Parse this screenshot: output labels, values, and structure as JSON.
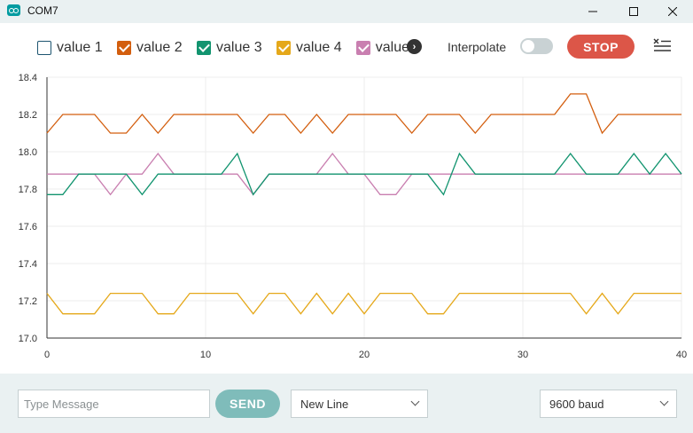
{
  "window": {
    "title": "COM7",
    "minimize_icon": "minimize-icon",
    "maximize_icon": "maximize-icon",
    "close_icon": "close-icon"
  },
  "toolbar": {
    "legend": [
      {
        "label": "value 1",
        "color": "#1d5570",
        "checked": false
      },
      {
        "label": "value 2",
        "color": "#d35e0e",
        "checked": true
      },
      {
        "label": "value 3",
        "color": "#12946f",
        "checked": true
      },
      {
        "label": "value 4",
        "color": "#e5a81a",
        "checked": true
      },
      {
        "label": "value",
        "color": "#c97fb0",
        "checked": true
      }
    ],
    "interpolate_label": "Interpolate",
    "interpolate_on": false,
    "stop_label": "STOP"
  },
  "bottom": {
    "message_placeholder": "Type Message",
    "message_value": "",
    "send_label": "SEND",
    "line_ending": "New Line",
    "baud_rate": "9600 baud"
  },
  "chart_data": {
    "type": "line",
    "title": "",
    "xlabel": "",
    "ylabel": "",
    "xlim": [
      0,
      40
    ],
    "ylim": [
      17.0,
      18.4
    ],
    "x_ticks": [
      0,
      10,
      20,
      30,
      40
    ],
    "y_ticks": [
      17.0,
      17.2,
      17.4,
      17.6,
      17.8,
      18.0,
      18.2,
      18.4
    ],
    "grid": true,
    "x": [
      0,
      1,
      2,
      3,
      4,
      5,
      6,
      7,
      8,
      9,
      10,
      11,
      12,
      13,
      14,
      15,
      16,
      17,
      18,
      19,
      20,
      21,
      22,
      23,
      24,
      25,
      26,
      27,
      28,
      29,
      30,
      31,
      32,
      33,
      34,
      35,
      36,
      37,
      38,
      39,
      40
    ],
    "series": [
      {
        "name": "value 2",
        "color": "#d35e0e",
        "values": [
          18.1,
          18.2,
          18.2,
          18.2,
          18.1,
          18.1,
          18.2,
          18.1,
          18.2,
          18.2,
          18.2,
          18.2,
          18.2,
          18.1,
          18.2,
          18.2,
          18.1,
          18.2,
          18.1,
          18.2,
          18.2,
          18.2,
          18.2,
          18.1,
          18.2,
          18.2,
          18.2,
          18.1,
          18.2,
          18.2,
          18.2,
          18.2,
          18.2,
          18.31,
          18.31,
          18.1,
          18.2,
          18.2,
          18.2,
          18.2,
          18.2
        ]
      },
      {
        "name": "value",
        "color": "#c97fb0",
        "values": [
          17.88,
          17.88,
          17.88,
          17.88,
          17.77,
          17.88,
          17.88,
          17.99,
          17.88,
          17.88,
          17.88,
          17.88,
          17.88,
          17.77,
          17.88,
          17.88,
          17.88,
          17.88,
          17.99,
          17.88,
          17.88,
          17.77,
          17.77,
          17.88,
          17.88,
          17.88,
          17.88,
          17.88,
          17.88,
          17.88,
          17.88,
          17.88,
          17.88,
          17.88,
          17.88,
          17.88,
          17.88,
          17.88,
          17.88,
          17.88,
          17.88
        ]
      },
      {
        "name": "value 3",
        "color": "#12946f",
        "values": [
          17.77,
          17.77,
          17.88,
          17.88,
          17.88,
          17.88,
          17.77,
          17.88,
          17.88,
          17.88,
          17.88,
          17.88,
          17.99,
          17.77,
          17.88,
          17.88,
          17.88,
          17.88,
          17.88,
          17.88,
          17.88,
          17.88,
          17.88,
          17.88,
          17.88,
          17.77,
          17.99,
          17.88,
          17.88,
          17.88,
          17.88,
          17.88,
          17.88,
          17.99,
          17.88,
          17.88,
          17.88,
          17.99,
          17.88,
          17.99,
          17.88
        ]
      },
      {
        "name": "value 4",
        "color": "#e5a81a",
        "values": [
          17.24,
          17.13,
          17.13,
          17.13,
          17.24,
          17.24,
          17.24,
          17.13,
          17.13,
          17.24,
          17.24,
          17.24,
          17.24,
          17.13,
          17.24,
          17.24,
          17.13,
          17.24,
          17.13,
          17.24,
          17.13,
          17.24,
          17.24,
          17.24,
          17.13,
          17.13,
          17.24,
          17.24,
          17.24,
          17.24,
          17.24,
          17.24,
          17.24,
          17.24,
          17.13,
          17.24,
          17.13,
          17.24,
          17.24,
          17.24,
          17.24
        ]
      }
    ]
  }
}
